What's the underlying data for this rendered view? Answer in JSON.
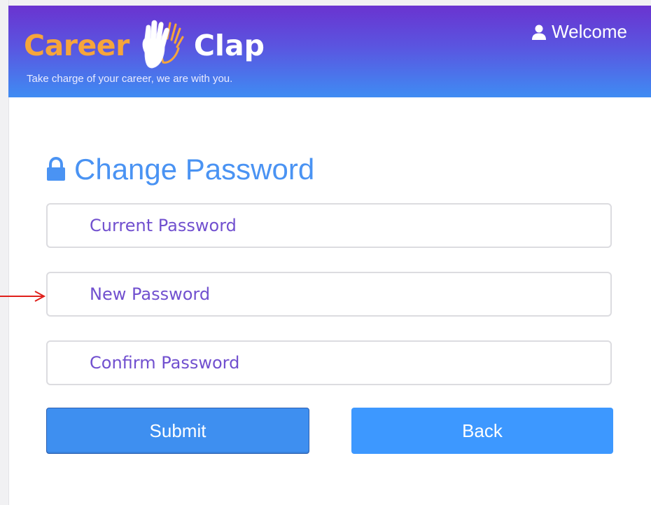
{
  "header": {
    "logo": {
      "word1": "Career",
      "word2": "Clap"
    },
    "tagline": "Take charge of your career, we are with you.",
    "user_menu": {
      "label": "Welcome",
      "icon": "user-icon"
    }
  },
  "form": {
    "title": "Change Password",
    "title_icon": "lock-icon",
    "fields": [
      {
        "placeholder": "Current Password",
        "value": ""
      },
      {
        "placeholder": "New Password",
        "value": ""
      },
      {
        "placeholder": "Confirm Password",
        "value": ""
      }
    ],
    "buttons": {
      "submit": "Submit",
      "back": "Back"
    }
  },
  "annotation": {
    "arrow_target": "New Password",
    "color": "#e0201b"
  },
  "colors": {
    "header_top": "#6a33d0",
    "header_bottom": "#3f8cf3",
    "logo_orange": "#f6a53b",
    "title_blue": "#4a93f3",
    "placeholder_purple": "#7150cf",
    "button_blue": "#3d98ff"
  }
}
